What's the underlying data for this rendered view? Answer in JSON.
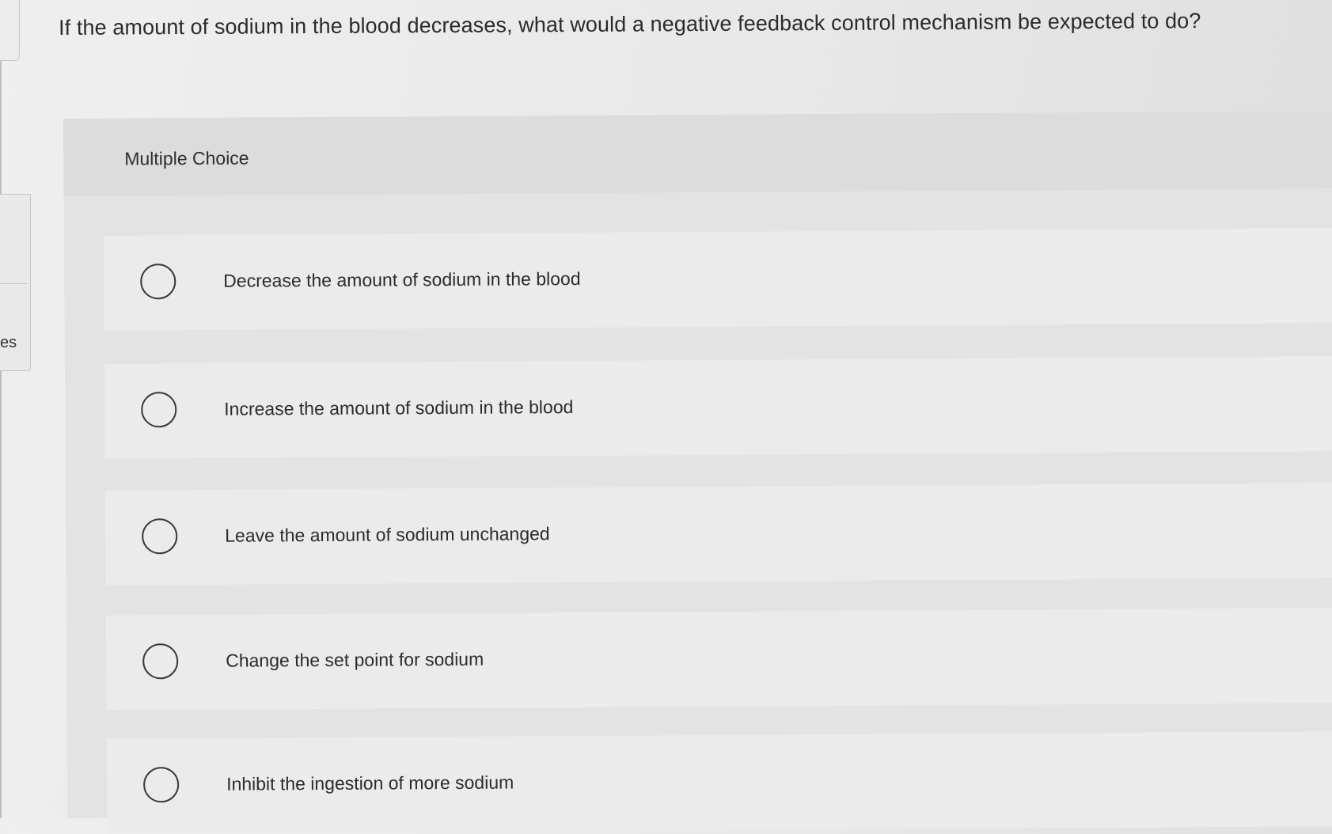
{
  "sidebar": {
    "fragment_text": "es"
  },
  "question": {
    "text": "If the amount of sodium in the blood decreases, what would a negative feedback control mechanism be expected to do?"
  },
  "multiple_choice": {
    "label": "Multiple Choice",
    "options": [
      {
        "label": "Decrease the amount of sodium in the blood",
        "selected": false
      },
      {
        "label": "Increase the amount of sodium in the blood",
        "selected": false
      },
      {
        "label": "Leave the amount of sodium unchanged",
        "selected": false
      },
      {
        "label": "Change the set point for sodium",
        "selected": false
      },
      {
        "label": "Inhibit the ingestion of more sodium",
        "selected": false
      }
    ]
  },
  "colors": {
    "background": "#e8e8e8",
    "panel": "#e3e3e3",
    "option_card": "#ebebeb",
    "text": "#2b2b2b"
  }
}
